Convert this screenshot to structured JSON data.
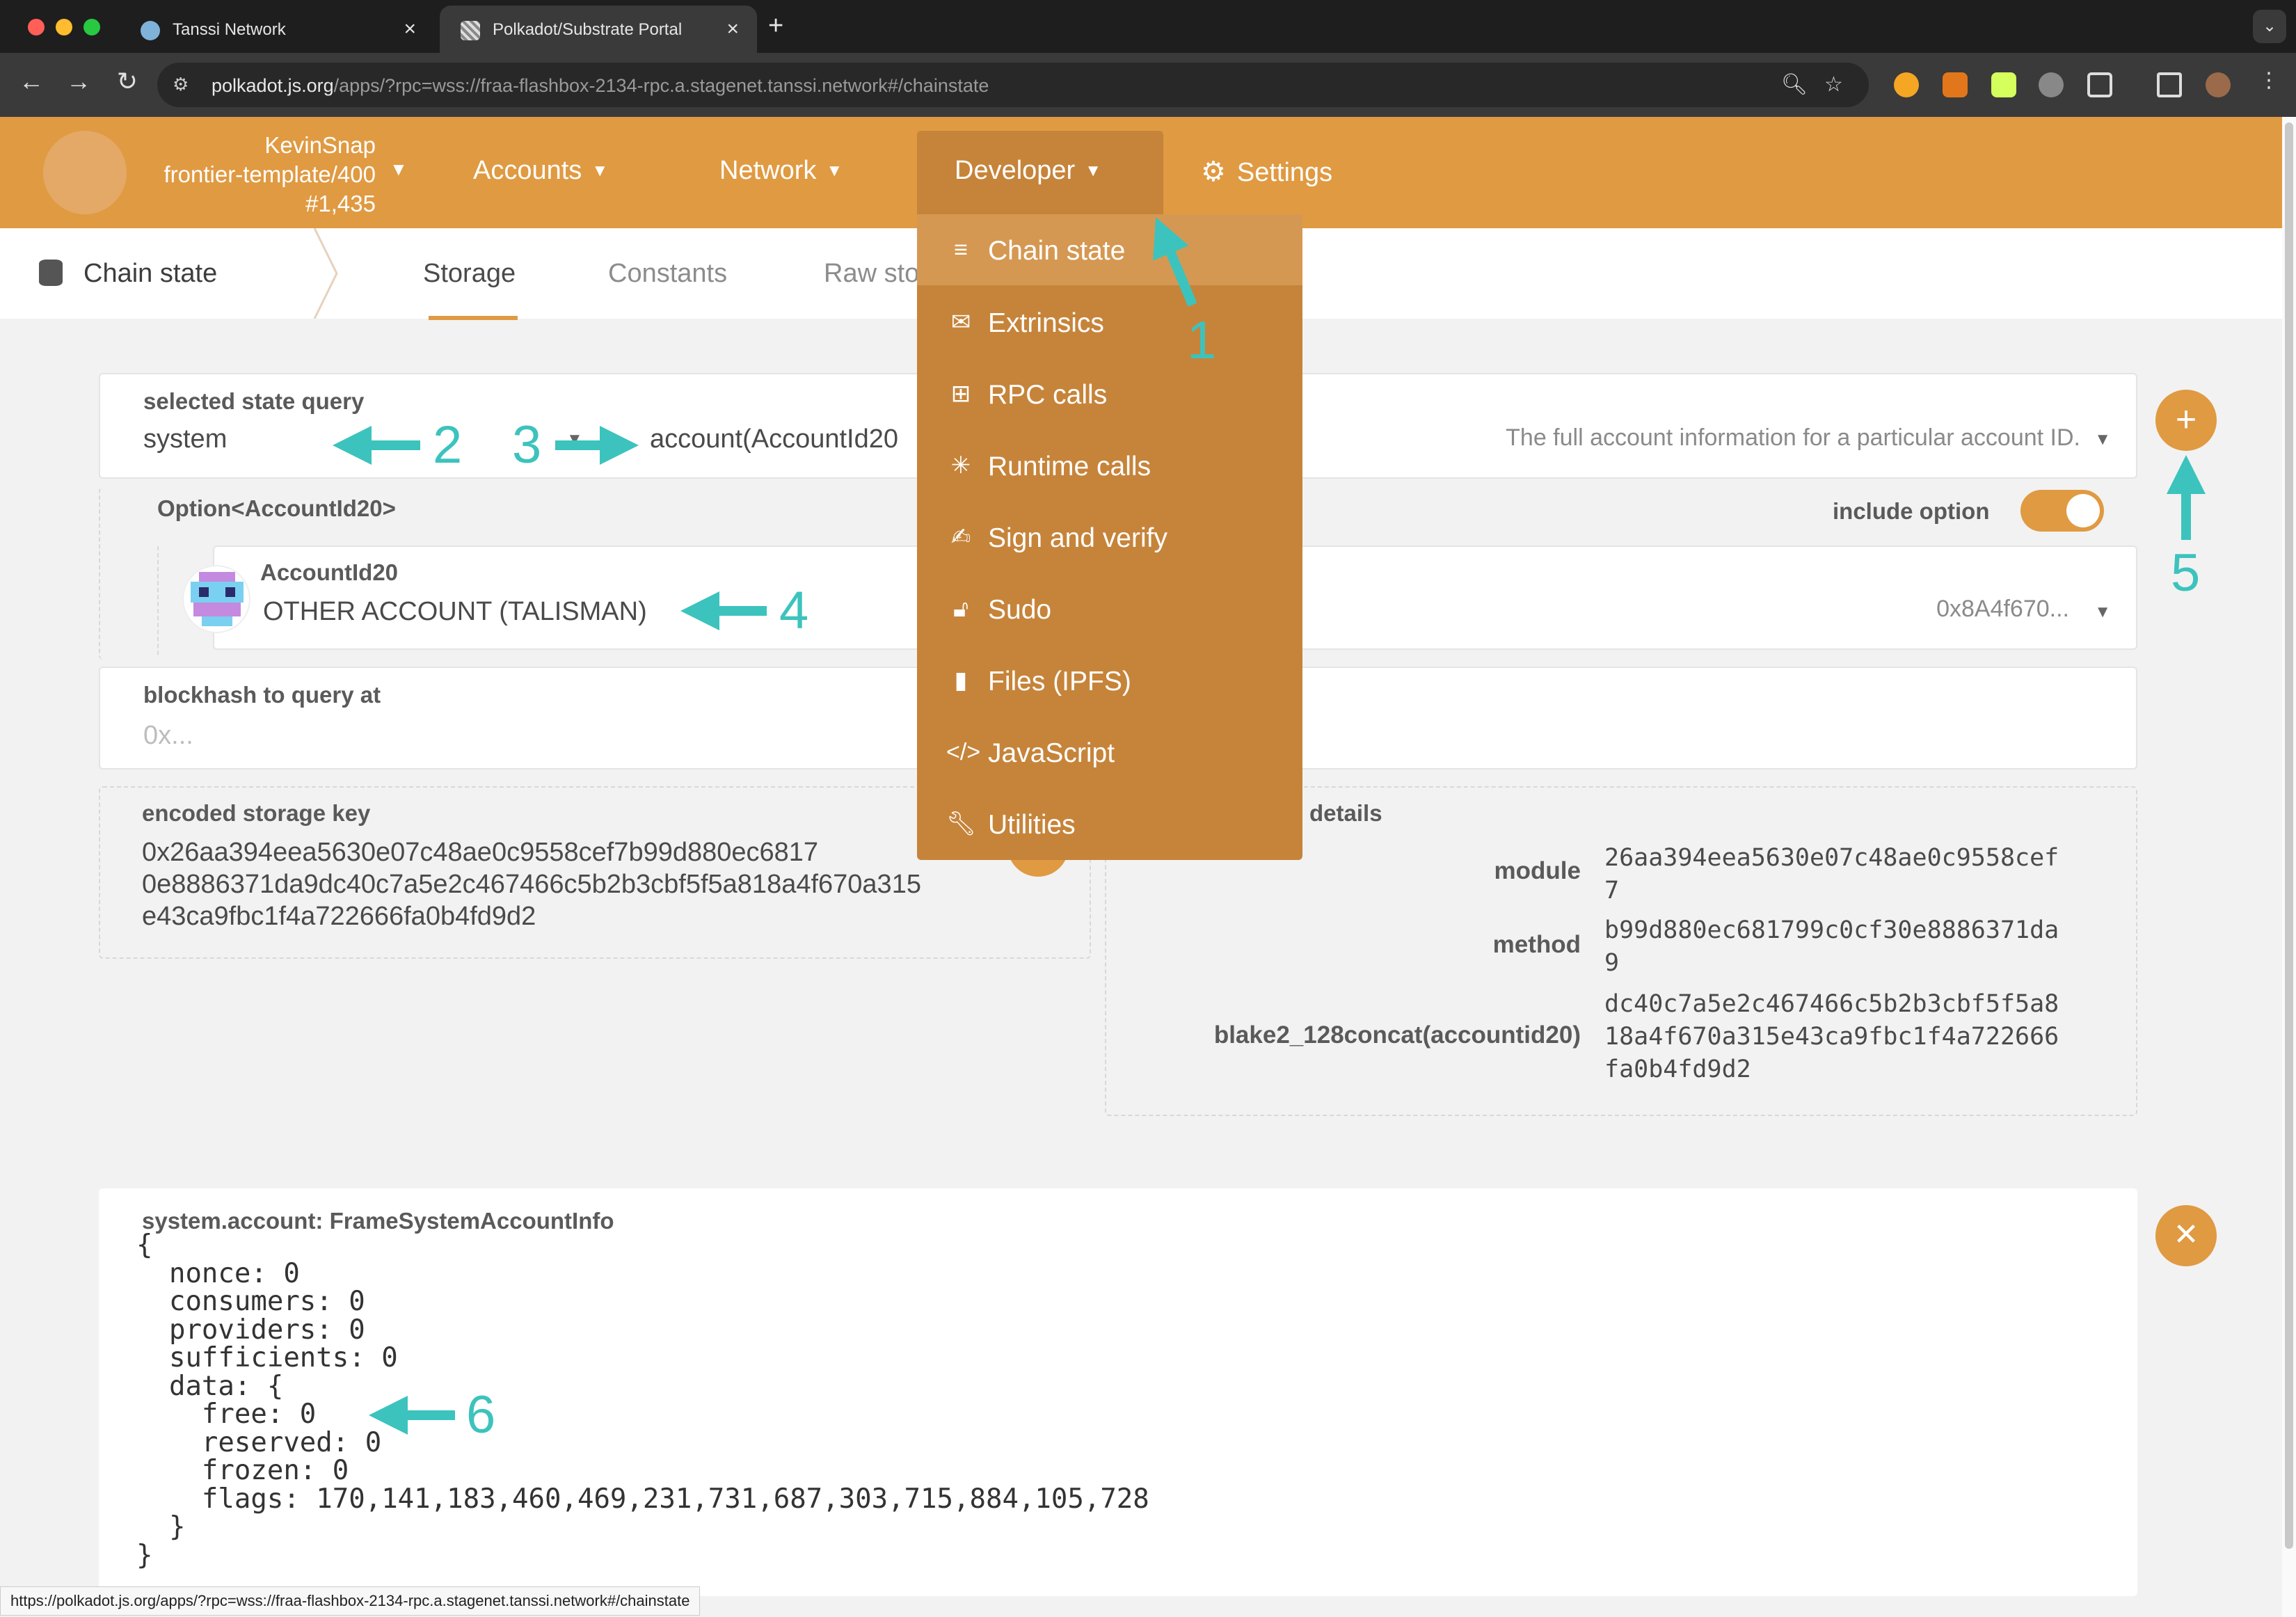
{
  "browser": {
    "tabs": [
      {
        "title": "Tanssi Network",
        "active": false
      },
      {
        "title": "Polkadot/Substrate Portal",
        "active": true
      }
    ],
    "url_host": "polkadot.js.org",
    "url_rest": "/apps/?rpc=wss://fraa-flashbox-2134-rpc.a.stagenet.tanssi.network#/chainstate",
    "status_url": "https://polkadot.js.org/apps/?rpc=wss://fraa-flashbox-2134-rpc.a.stagenet.tanssi.network#/chainstate"
  },
  "header": {
    "account_name": "KevinSnap",
    "chain_name": "frontier-template/400",
    "block_number": "#1,435",
    "menus": [
      "Accounts",
      "Network",
      "Developer",
      "Settings"
    ]
  },
  "developer_menu": {
    "items": [
      {
        "label": "Chain state",
        "icon": "database-icon"
      },
      {
        "label": "Extrinsics",
        "icon": "envelope-icon"
      },
      {
        "label": "RPC calls",
        "icon": "network-icon"
      },
      {
        "label": "Runtime calls",
        "icon": "arrows-icon"
      },
      {
        "label": "Sign and verify",
        "icon": "signature-icon"
      },
      {
        "label": "Sudo",
        "icon": "unlock-icon"
      },
      {
        "label": "Files (IPFS)",
        "icon": "file-icon"
      },
      {
        "label": "JavaScript",
        "icon": "code-icon"
      },
      {
        "label": "Utilities",
        "icon": "wrench-icon"
      }
    ]
  },
  "subnav": {
    "section": "Chain state",
    "tabs": [
      "Storage",
      "Constants",
      "Raw sto"
    ]
  },
  "query": {
    "selected_label": "selected state query",
    "module": "system",
    "method": "account(AccountId20",
    "description": "The full account information for a particular account ID.",
    "option_label": "Option<AccountId20>",
    "include_option_label": "include option",
    "account_type_label": "AccountId20",
    "account_name": "OTHER ACCOUNT (TALISMAN)",
    "account_address": "0x8A4f670...",
    "blockhash_label": "blockhash to query at",
    "blockhash_placeholder": "0x..."
  },
  "encoded": {
    "label": "encoded storage key",
    "lines": [
      "0x26aa394eea5630e07c48ae0c9558cef7b99d880ec6817",
      "0e8886371da9dc40c7a5e2c467466c5b2b3cbf5f5a818a4f670a315",
      "e43ca9fbc1f4a722666fa0b4fd9d2"
    ]
  },
  "details": {
    "label": "details",
    "rows": [
      {
        "key": "module",
        "value": "26aa394eea5630e07c48ae0c9558cef\n7"
      },
      {
        "key": "method",
        "value": "b99d880ec681799c0cf30e8886371da\n9"
      },
      {
        "key": "blake2_128concat(accountid20)",
        "value": "dc40c7a5e2c467466c5b2b3cbf5f5a8\n18a4f670a315e43ca9fbc1f4a722666\nfa0b4fd9d2"
      }
    ]
  },
  "result": {
    "title": "system.account: FrameSystemAccountInfo",
    "body": "{\n  nonce: 0\n  consumers: 0\n  providers: 0\n  sufficients: 0\n  data: {\n    free: 0\n    reserved: 0\n    frozen: 0\n    flags: 170,141,183,460,469,231,731,687,303,715,884,105,728\n  }\n}"
  },
  "annotations": [
    "1",
    "2",
    "3",
    "4",
    "5",
    "6"
  ],
  "colors": {
    "accent": "#e09a42",
    "menu": "#c6843a",
    "annotation": "#3cc3bd"
  }
}
